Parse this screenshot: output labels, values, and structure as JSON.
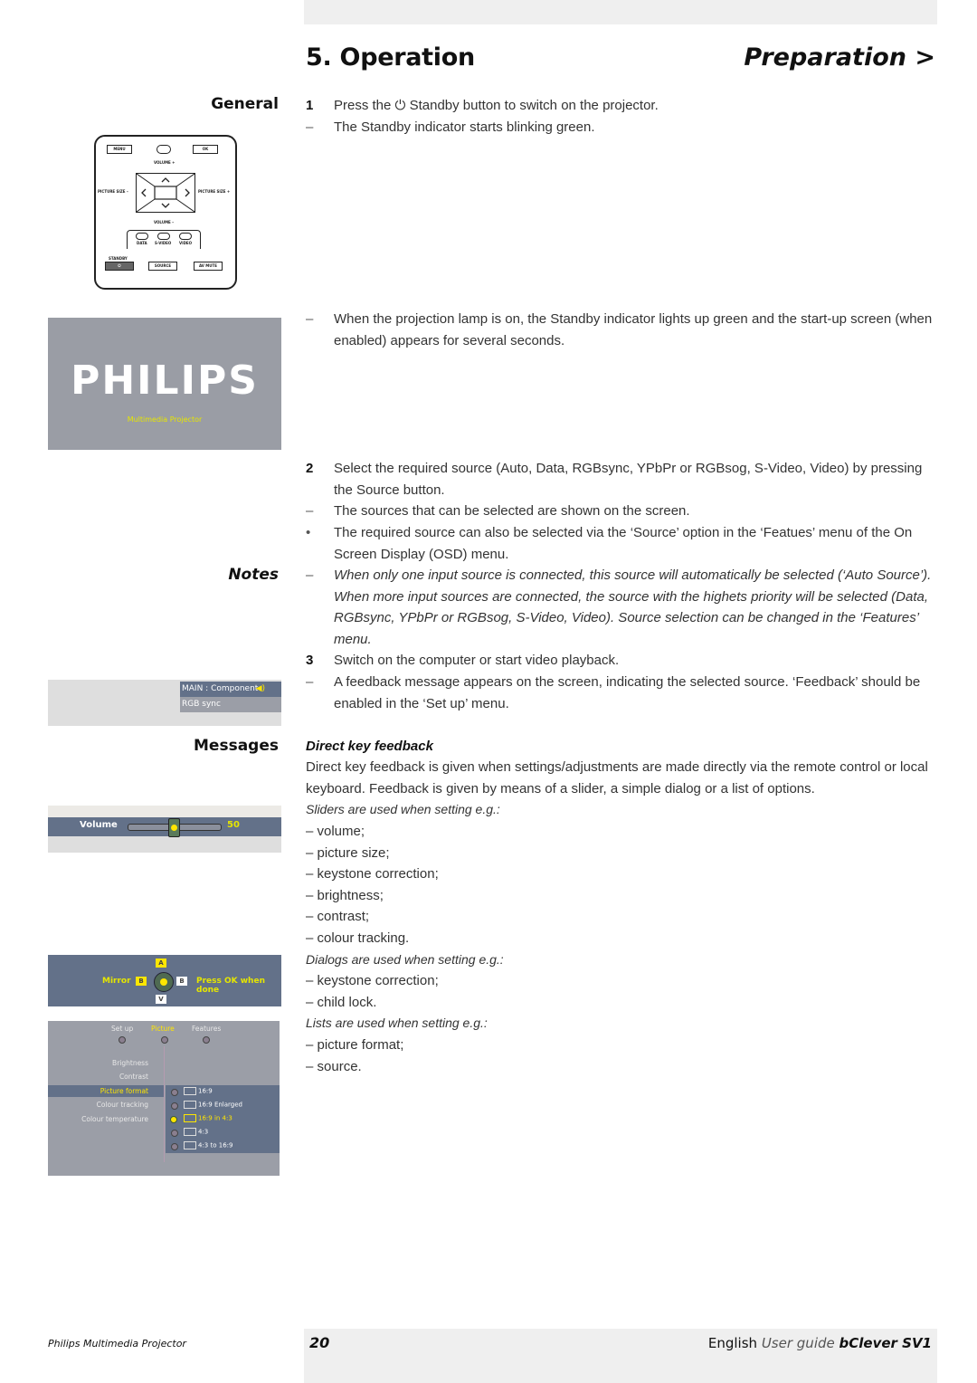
{
  "header": {
    "chapter_title": "5. Operation",
    "section_link": "Preparation >"
  },
  "side_labels": {
    "general": "General",
    "notes": "Notes",
    "messages": "Messages"
  },
  "steps": [
    {
      "marker": "1",
      "text_before_icon": "Press the",
      "icon": "power-icon",
      "text_after_icon": "Standby button to switch on the projector."
    },
    {
      "marker": "–",
      "text": "The Standby indicator starts blinking green."
    },
    {
      "marker": "–",
      "text": "When the projection lamp is on, the Standby indicator lights up green and the start-up screen (when enabled) appears for several seconds."
    },
    {
      "marker": "2",
      "text": "Select the required source (Auto, Data, RGBsync, YPbPr or RGBsog, S-Video, Video) by pressing the Source button."
    },
    {
      "marker": "–",
      "text": "The sources that can be selected are shown on the screen."
    },
    {
      "marker": "•",
      "text": "The required source can also be selected via the ‘Source’ option in the ‘Featues’ menu of the On Screen Display (OSD) menu."
    },
    {
      "marker": "–",
      "text": "When only one input source is connected, this source will automatically be selected (‘Auto Source’). When more input sources are connected, the source with the highets priority will be selected (Data, RGBsync, YPbPr or RGBsog, S-Video, Video). Source selection can be changed in the ‘Features’ menu."
    },
    {
      "marker": "3",
      "text": "Switch on the computer or start video playback."
    },
    {
      "marker": "–",
      "text": "A feedback message appears on the screen, indicating the selected source. ‘Feedback’ should be enabled in the ‘Set up’ menu."
    }
  ],
  "feedback": {
    "heading": "Direct key feedback",
    "intro": "Direct key feedback is given when settings/adjustments are made directly via the remote control or local keyboard. Feedback is given by means of a slider, a simple dialog or a list of options.",
    "sliders_heading": "Sliders are used when setting e.g.:",
    "sliders": [
      "– volume;",
      "– picture size;",
      "– keystone correction;",
      "– brightness;",
      "– contrast;",
      "– colour tracking."
    ],
    "dialogs_heading": "Dialogs are used when setting e.g.:",
    "dialogs": [
      "– keystone correction;",
      "– child lock."
    ],
    "lists_heading": "Lists are used when setting e.g.:",
    "lists": [
      "– picture format;",
      "– source."
    ]
  },
  "remote": {
    "menu": "MENU",
    "ok": "OK",
    "volume_plus": "VOLUME +",
    "volume_minus": "VOLUME –",
    "picture_size_minus": "PICTURE SIZE –",
    "picture_size_plus": "PICTURE SIZE +",
    "data": "DATA",
    "svideo": "S-VIDEO",
    "video": "VIDEO",
    "standby": "STANDBY",
    "source": "SOURCE",
    "av_mute": "AV MUTE"
  },
  "splash": {
    "logo": "PHILIPS",
    "subtitle": "Multimedia Projector"
  },
  "source_message": {
    "line1": "MAIN : Component",
    "line2": "RGB sync",
    "icon": "speaker-icon"
  },
  "volume_slider": {
    "label": "Volume",
    "value": "50",
    "level_percent": 50
  },
  "mirror_dialog": {
    "label": "Mirror",
    "key_up": "A",
    "key_left": "B",
    "key_right": "B",
    "key_down": "V",
    "hint": "Press OK when done"
  },
  "osd_menu": {
    "tabs": [
      "Set up",
      "Picture",
      "Features"
    ],
    "active_tab": "Picture",
    "items": [
      "Brightness",
      "Contrast",
      "Picture format",
      "Colour tracking",
      "Colour temperature"
    ],
    "selected_item": "Picture format",
    "options": [
      "16:9",
      "16:9 Enlarged",
      "16:9 in 4:3",
      "4:3",
      "4:3 to 16:9"
    ],
    "selected_option": "16:9 in 4:3"
  },
  "footer": {
    "product": "Philips Multimedia Projector",
    "page_number": "20",
    "language": "English",
    "guide": "User guide",
    "model": "bClever SV1"
  },
  "colors": {
    "osd_blue": "#637189",
    "osd_grey": "#9b9ea7",
    "highlight_yellow": "#ffe600",
    "band_grey": "#efefef"
  }
}
